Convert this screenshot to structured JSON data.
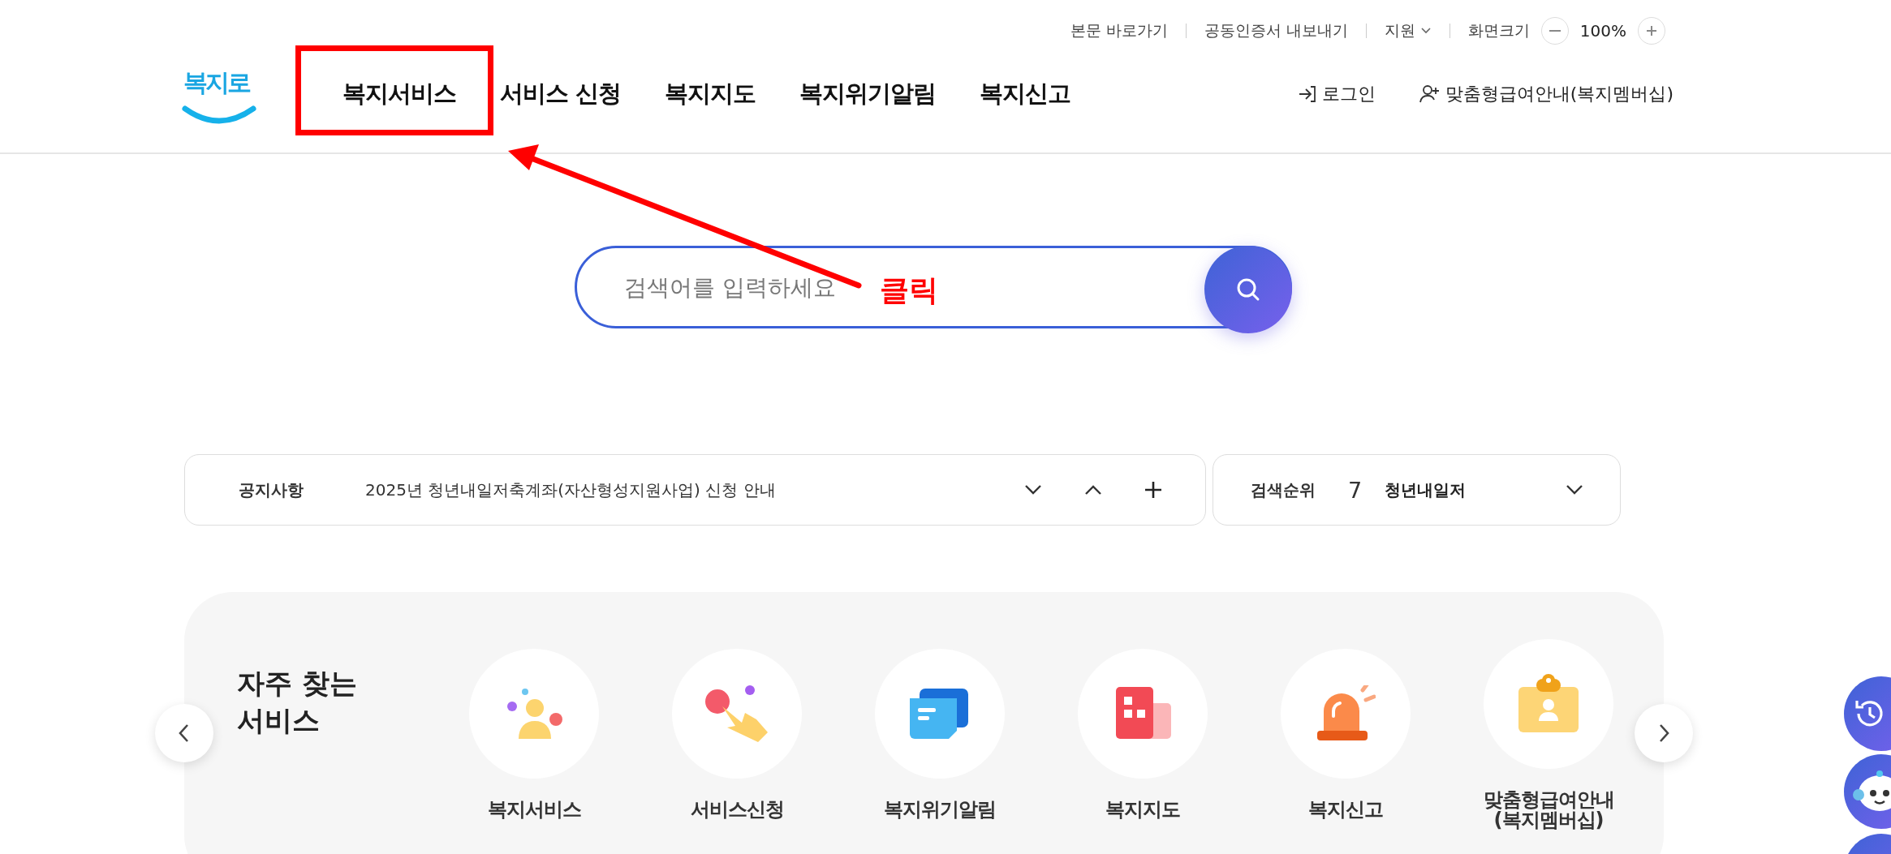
{
  "header": {
    "logo": "복지로",
    "utility_links": [
      "본문 바로가기",
      "공동인증서 내보내기",
      "지원"
    ],
    "zoom": {
      "label": "화면크기",
      "value": "100%"
    },
    "nav": [
      "복지서비스",
      "서비스 신청",
      "복지지도",
      "복지위기알림",
      "복지신고"
    ],
    "login": "로그인",
    "membership": "맞춤형급여안내(복지멤버십)"
  },
  "annotation": {
    "label": "클릭"
  },
  "search": {
    "placeholder": "검색어를 입력하세요"
  },
  "notice": {
    "label": "공지사항",
    "text": "2025년 청년내일저축계좌(자산형성지원사업) 신청 안내"
  },
  "ranking": {
    "label": "검색순위",
    "rank": "7",
    "text": "청년내일저"
  },
  "frequent": {
    "title": "자주 찾는\n서비스",
    "items": [
      "복지서비스",
      "서비스신청",
      "복지위기알림",
      "복지지도",
      "복지신고",
      "맞춤형급여안내\n(복지멤버십)"
    ]
  }
}
